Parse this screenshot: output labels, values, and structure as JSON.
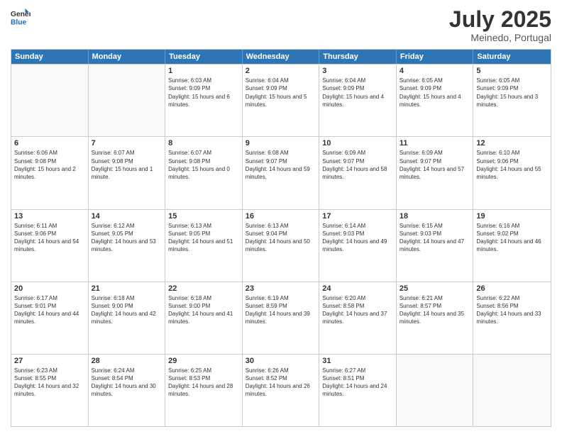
{
  "header": {
    "logo_general": "General",
    "logo_blue": "Blue",
    "month": "July 2025",
    "location": "Meinedo, Portugal"
  },
  "weekdays": [
    "Sunday",
    "Monday",
    "Tuesday",
    "Wednesday",
    "Thursday",
    "Friday",
    "Saturday"
  ],
  "rows": [
    [
      {
        "day": "",
        "empty": true
      },
      {
        "day": "",
        "empty": true
      },
      {
        "day": "1",
        "sunrise": "6:03 AM",
        "sunset": "9:09 PM",
        "daylight": "15 hours and 6 minutes."
      },
      {
        "day": "2",
        "sunrise": "6:04 AM",
        "sunset": "9:09 PM",
        "daylight": "15 hours and 5 minutes."
      },
      {
        "day": "3",
        "sunrise": "6:04 AM",
        "sunset": "9:09 PM",
        "daylight": "15 hours and 4 minutes."
      },
      {
        "day": "4",
        "sunrise": "6:05 AM",
        "sunset": "9:09 PM",
        "daylight": "15 hours and 4 minutes."
      },
      {
        "day": "5",
        "sunrise": "6:05 AM",
        "sunset": "9:09 PM",
        "daylight": "15 hours and 3 minutes."
      }
    ],
    [
      {
        "day": "6",
        "sunrise": "6:06 AM",
        "sunset": "9:08 PM",
        "daylight": "15 hours and 2 minutes."
      },
      {
        "day": "7",
        "sunrise": "6:07 AM",
        "sunset": "9:08 PM",
        "daylight": "15 hours and 1 minute."
      },
      {
        "day": "8",
        "sunrise": "6:07 AM",
        "sunset": "9:08 PM",
        "daylight": "15 hours and 0 minutes."
      },
      {
        "day": "9",
        "sunrise": "6:08 AM",
        "sunset": "9:07 PM",
        "daylight": "14 hours and 59 minutes."
      },
      {
        "day": "10",
        "sunrise": "6:09 AM",
        "sunset": "9:07 PM",
        "daylight": "14 hours and 58 minutes."
      },
      {
        "day": "11",
        "sunrise": "6:09 AM",
        "sunset": "9:07 PM",
        "daylight": "14 hours and 57 minutes."
      },
      {
        "day": "12",
        "sunrise": "6:10 AM",
        "sunset": "9:06 PM",
        "daylight": "14 hours and 55 minutes."
      }
    ],
    [
      {
        "day": "13",
        "sunrise": "6:11 AM",
        "sunset": "9:06 PM",
        "daylight": "14 hours and 54 minutes."
      },
      {
        "day": "14",
        "sunrise": "6:12 AM",
        "sunset": "9:05 PM",
        "daylight": "14 hours and 53 minutes."
      },
      {
        "day": "15",
        "sunrise": "6:13 AM",
        "sunset": "9:05 PM",
        "daylight": "14 hours and 51 minutes."
      },
      {
        "day": "16",
        "sunrise": "6:13 AM",
        "sunset": "9:04 PM",
        "daylight": "14 hours and 50 minutes."
      },
      {
        "day": "17",
        "sunrise": "6:14 AM",
        "sunset": "9:03 PM",
        "daylight": "14 hours and 49 minutes."
      },
      {
        "day": "18",
        "sunrise": "6:15 AM",
        "sunset": "9:03 PM",
        "daylight": "14 hours and 47 minutes."
      },
      {
        "day": "19",
        "sunrise": "6:16 AM",
        "sunset": "9:02 PM",
        "daylight": "14 hours and 46 minutes."
      }
    ],
    [
      {
        "day": "20",
        "sunrise": "6:17 AM",
        "sunset": "9:01 PM",
        "daylight": "14 hours and 44 minutes."
      },
      {
        "day": "21",
        "sunrise": "6:18 AM",
        "sunset": "9:00 PM",
        "daylight": "14 hours and 42 minutes."
      },
      {
        "day": "22",
        "sunrise": "6:18 AM",
        "sunset": "9:00 PM",
        "daylight": "14 hours and 41 minutes."
      },
      {
        "day": "23",
        "sunrise": "6:19 AM",
        "sunset": "8:59 PM",
        "daylight": "14 hours and 39 minutes."
      },
      {
        "day": "24",
        "sunrise": "6:20 AM",
        "sunset": "8:58 PM",
        "daylight": "14 hours and 37 minutes."
      },
      {
        "day": "25",
        "sunrise": "6:21 AM",
        "sunset": "8:57 PM",
        "daylight": "14 hours and 35 minutes."
      },
      {
        "day": "26",
        "sunrise": "6:22 AM",
        "sunset": "8:56 PM",
        "daylight": "14 hours and 33 minutes."
      }
    ],
    [
      {
        "day": "27",
        "sunrise": "6:23 AM",
        "sunset": "8:55 PM",
        "daylight": "14 hours and 32 minutes."
      },
      {
        "day": "28",
        "sunrise": "6:24 AM",
        "sunset": "8:54 PM",
        "daylight": "14 hours and 30 minutes."
      },
      {
        "day": "29",
        "sunrise": "6:25 AM",
        "sunset": "8:53 PM",
        "daylight": "14 hours and 28 minutes."
      },
      {
        "day": "30",
        "sunrise": "6:26 AM",
        "sunset": "8:52 PM",
        "daylight": "14 hours and 26 minutes."
      },
      {
        "day": "31",
        "sunrise": "6:27 AM",
        "sunset": "8:51 PM",
        "daylight": "14 hours and 24 minutes."
      },
      {
        "day": "",
        "empty": true
      },
      {
        "day": "",
        "empty": true
      }
    ]
  ]
}
